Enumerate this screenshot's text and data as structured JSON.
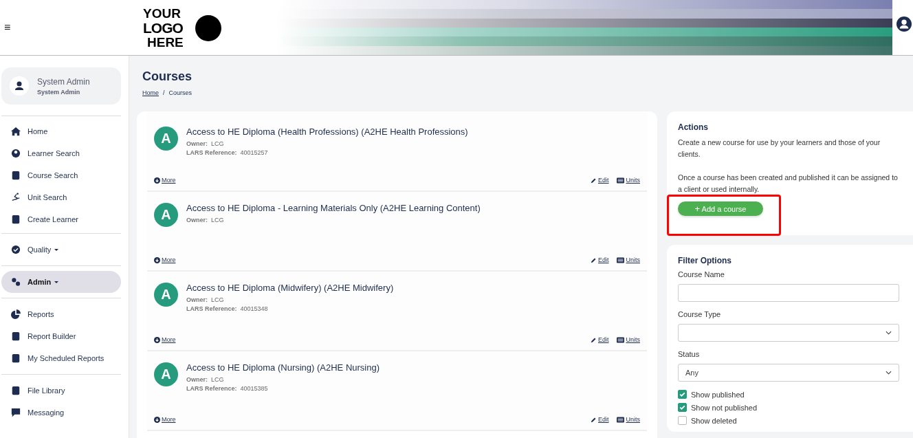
{
  "header": {
    "menu_glyph": "≡",
    "logo": {
      "lines": [
        "YOUR",
        "LOGO",
        "HERE"
      ]
    }
  },
  "user": {
    "name": "System Admin",
    "role": "System Admin"
  },
  "sidebar": {
    "groups": [
      {
        "items": [
          {
            "label": "Home",
            "kind": "link",
            "selected": false
          },
          {
            "label": "Learner Search",
            "kind": "link",
            "selected": false
          },
          {
            "label": "Course Search",
            "kind": "link",
            "selected": false
          },
          {
            "label": "Unit Search",
            "kind": "link",
            "selected": false
          },
          {
            "label": "Create Learner",
            "kind": "link",
            "selected": false
          }
        ]
      },
      {
        "items": [
          {
            "label": "Quality",
            "kind": "dropdown",
            "selected": false
          }
        ]
      },
      {
        "items": [
          {
            "label": "Admin",
            "kind": "dropdown",
            "selected": true
          }
        ]
      },
      {
        "items": [
          {
            "label": "Reports",
            "kind": "link",
            "selected": false
          },
          {
            "label": "Report Builder",
            "kind": "link",
            "selected": false
          },
          {
            "label": "My Scheduled Reports",
            "kind": "link",
            "selected": false
          }
        ]
      },
      {
        "items": [
          {
            "label": "File Library",
            "kind": "link",
            "selected": false
          },
          {
            "label": "Messaging",
            "kind": "link",
            "selected": false
          }
        ]
      }
    ]
  },
  "page": {
    "title": "Courses",
    "breadcrumb": [
      {
        "label": "Home",
        "kind": "link"
      },
      {
        "label": "/",
        "kind": "separator"
      },
      {
        "label": "Courses",
        "kind": "current"
      }
    ]
  },
  "courses": [
    {
      "avatar": "A",
      "title": "Access to HE Diploma (Health Professions) (A2HE Health Professions)",
      "fields": [
        {
          "label": "Owner:",
          "value": "LCG"
        },
        {
          "label": "LARS Reference:",
          "value": "40015257"
        }
      ],
      "more": "More",
      "edit": "Edit",
      "units": "Units"
    },
    {
      "avatar": "A",
      "title": "Access to HE Diploma - Learning Materials Only (A2HE Learning Content)",
      "fields": [
        {
          "label": "Owner:",
          "value": "LCG"
        }
      ],
      "more": "More",
      "edit": "Edit",
      "units": "Units"
    },
    {
      "avatar": "A",
      "title": "Access to HE Diploma (Midwifery) (A2HE Midwifery)",
      "fields": [
        {
          "label": "Owner:",
          "value": "LCG"
        },
        {
          "label": "LARS Reference:",
          "value": "40015348"
        }
      ],
      "more": "More",
      "edit": "Edit",
      "units": "Units"
    },
    {
      "avatar": "A",
      "title": "Access to HE Diploma (Nursing) (A2HE Nursing)",
      "fields": [
        {
          "label": "Owner:",
          "value": "LCG"
        },
        {
          "label": "LARS Reference:",
          "value": "40015385"
        }
      ],
      "more": "More",
      "edit": "Edit",
      "units": "Units"
    }
  ],
  "actions": {
    "title": "Actions",
    "paragraphs": [
      "Create a new course for use by your learners and those of your clients.",
      "Once a course has been created and published it can be assigned to a client or used internally."
    ],
    "button": {
      "glyph": "+",
      "label": "Add a course",
      "highlighted": true
    }
  },
  "filters": {
    "title": "Filter Options",
    "fields": [
      {
        "label": "Course Name",
        "kind": "text"
      },
      {
        "label": "Course Type",
        "kind": "select"
      },
      {
        "label": "Status",
        "kind": "select",
        "value": "Any"
      }
    ],
    "checkboxes": [
      {
        "label": "Show published",
        "checked": true
      },
      {
        "label": "Show not published",
        "checked": true
      },
      {
        "label": "Show deleted",
        "checked": false
      }
    ]
  }
}
